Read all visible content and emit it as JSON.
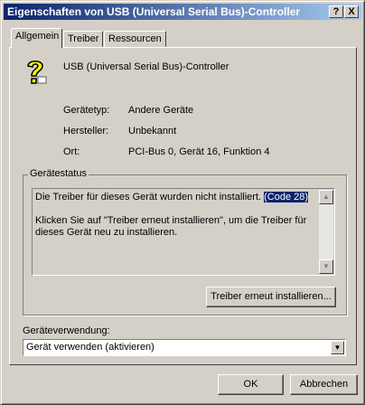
{
  "window": {
    "title": "Eigenschaften von USB (Universal Serial Bus)-Controller",
    "help_label": "?",
    "close_label": "X"
  },
  "tabs": [
    {
      "label": "Allgemein"
    },
    {
      "label": "Treiber"
    },
    {
      "label": "Ressourcen"
    }
  ],
  "device": {
    "name": "USB (Universal Serial Bus)-Controller",
    "icon": "unknown-device-question-icon",
    "type_label": "Gerätetyp:",
    "type_value": "Andere Geräte",
    "manufacturer_label": "Hersteller:",
    "manufacturer_value": "Unbekannt",
    "location_label": "Ort:",
    "location_value": "PCI-Bus 0, Gerät 16, Funktion 4"
  },
  "status": {
    "group_title": "Gerätestatus",
    "line1": "Die Treiber für dieses Gerät wurden nicht installiert.",
    "code": "(Code 28)",
    "line2": "Klicken Sie auf \"Treiber erneut installieren\", um die Treiber für dieses Gerät neu zu installieren.",
    "reinstall_button": "Treiber erneut installieren..."
  },
  "usage": {
    "label": "Geräteverwendung:",
    "selected": "Gerät verwenden (aktivieren)"
  },
  "footer": {
    "ok": "OK",
    "cancel": "Abbrechen"
  },
  "colors": {
    "titlebar_start": "#0a246a",
    "titlebar_end": "#a6caf0",
    "face": "#d4d0c8",
    "icon_yellow": "#ffff00"
  }
}
